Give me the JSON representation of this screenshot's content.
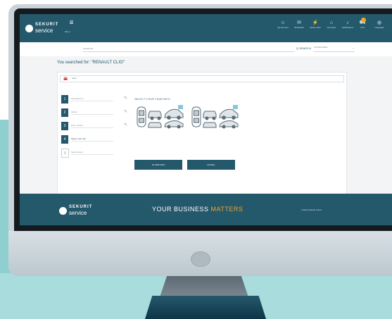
{
  "header": {
    "brand_top": "SEKURIT",
    "brand_bottom": "service",
    "menu_label": "Menu",
    "nav": [
      {
        "label": "My Account",
        "icon": "user-icon"
      },
      {
        "label": "Newsletter",
        "icon": "mail-icon"
      },
      {
        "label": "Quick order",
        "icon": "bolt-icon"
      },
      {
        "label": "Favorites",
        "icon": "home-icon"
      },
      {
        "label": "Notifications",
        "icon": "bell-icon"
      },
      {
        "label": "Cart",
        "icon": "cart-icon"
      },
      {
        "label": "Language",
        "icon": "globe-icon"
      }
    ]
  },
  "search": {
    "placeholder": "renault clio",
    "button_label": "Q SEARCH",
    "category": "CATEGORIES"
  },
  "results": {
    "searched_text": "You searched for: \"RENAULT CLIO\""
  },
  "panel": {
    "category": "Cars",
    "steps": [
      {
        "num": "1",
        "label": "Manufacturer"
      },
      {
        "num": "2",
        "label": "Model"
      },
      {
        "num": "3",
        "label": "Body Variant"
      },
      {
        "num": "4",
        "label": "Select Year Info"
      },
      {
        "num": "5",
        "label": "Select Glass"
      }
    ],
    "year_info_title": "SELECT YOUR YEAR INFO",
    "year_buttons": [
      "10.2005-2012",
      "10.2012-"
    ]
  },
  "footer": {
    "tagline_main": "YOUR BUSINESS ",
    "tagline_highlight": "MATTERS",
    "note": "A Saint-Gobain brand"
  },
  "colors": {
    "primary": "#24586b",
    "accent": "#f3a527",
    "background_teal": "#8fcfd0"
  }
}
